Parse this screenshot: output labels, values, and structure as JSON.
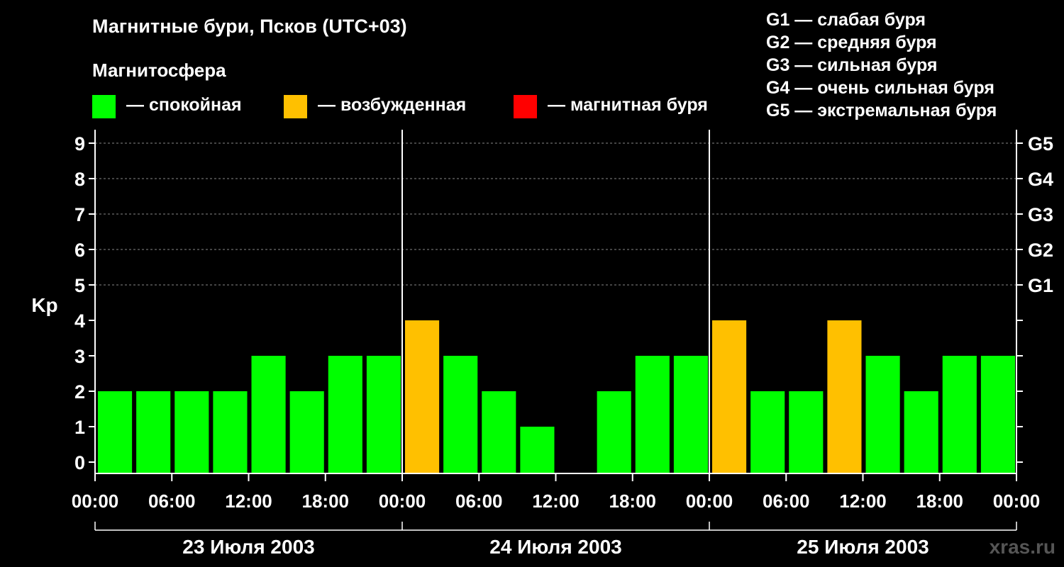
{
  "title": "Магнитные бури, Псков (UTC+03)",
  "subtitle": "Магнитосфера",
  "legend": [
    {
      "label": "— спокойная",
      "color": "#00ff00"
    },
    {
      "label": "— возбужденная",
      "color": "#ffc000"
    },
    {
      "label": "— магнитная буря",
      "color": "#ff0000"
    }
  ],
  "g_legend": [
    "G1 — слабая буря",
    "G2 — средняя буря",
    "G3 — сильная буря",
    "G4 — очень сильная буря",
    "G5 — экстремальная буря"
  ],
  "watermark": "xras.ru",
  "chart_data": {
    "type": "bar",
    "ylabel": "Kp",
    "ylim": [
      0,
      9
    ],
    "yticks": [
      "0",
      "1",
      "2",
      "3",
      "4",
      "5",
      "6",
      "7",
      "8",
      "9"
    ],
    "right_ticks": [
      {
        "value": 5,
        "label": "G1"
      },
      {
        "value": 6,
        "label": "G2"
      },
      {
        "value": 7,
        "label": "G3"
      },
      {
        "value": 8,
        "label": "G4"
      },
      {
        "value": 9,
        "label": "G5"
      }
    ],
    "xtick_labels": [
      "00:00",
      "06:00",
      "12:00",
      "18:00",
      "00:00",
      "06:00",
      "12:00",
      "18:00",
      "00:00",
      "06:00",
      "12:00",
      "18:00",
      "00:00"
    ],
    "days": [
      "23 Июля 2003",
      "24 Июля 2003",
      "25 Июля 2003"
    ],
    "values": [
      2,
      2,
      2,
      2,
      3,
      2,
      3,
      3,
      4,
      3,
      2,
      1,
      0,
      2,
      3,
      3,
      4,
      2,
      2,
      4,
      3,
      2,
      3,
      3
    ],
    "colors": {
      "quiet": "#00ff00",
      "active": "#ffc000",
      "storm": "#ff0000"
    },
    "grid": "dashed at 5-9"
  }
}
